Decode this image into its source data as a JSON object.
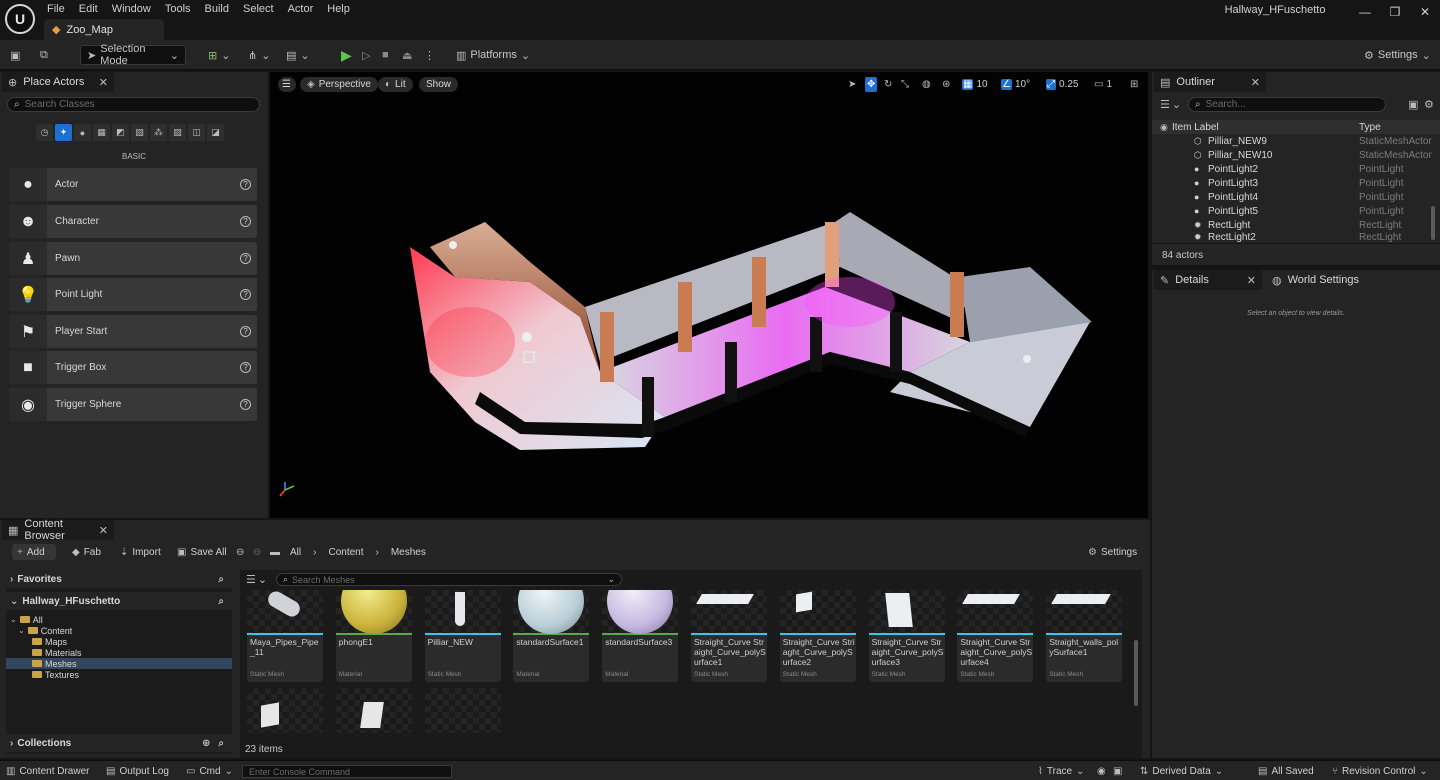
{
  "window": {
    "logo_letter": "U",
    "menu": [
      "File",
      "Edit",
      "Window",
      "Tools",
      "Build",
      "Select",
      "Actor",
      "Help"
    ],
    "document_tab": "Zoo_Map",
    "project_name": "Hallway_HFuschetto"
  },
  "toolbar": {
    "selection_mode": "Selection Mode",
    "platforms": "Platforms",
    "settings": "Settings"
  },
  "place_actors": {
    "tab_label": "Place Actors",
    "search_placeholder": "Search Classes",
    "category_label": "BASIC",
    "items": [
      {
        "label": "Actor"
      },
      {
        "label": "Character"
      },
      {
        "label": "Pawn"
      },
      {
        "label": "Point Light"
      },
      {
        "label": "Player Start"
      },
      {
        "label": "Trigger Box"
      },
      {
        "label": "Trigger Sphere"
      }
    ]
  },
  "viewport": {
    "perspective": "Perspective",
    "lit": "Lit",
    "show": "Show",
    "grid_snap": "10",
    "rotation_snap": "10°",
    "scale_snap": "0.25",
    "camera_speed": "1"
  },
  "outliner": {
    "tab_label": "Outliner",
    "search_placeholder": "Search...",
    "col_label": "Item Label",
    "col_type": "Type",
    "rows": [
      {
        "name": "Pilliar_NEW9",
        "type": "StaticMeshActor"
      },
      {
        "name": "Pilliar_NEW10",
        "type": "StaticMeshActor"
      },
      {
        "name": "PointLight2",
        "type": "PointLight"
      },
      {
        "name": "PointLight3",
        "type": "PointLight"
      },
      {
        "name": "PointLight4",
        "type": "PointLight"
      },
      {
        "name": "PointLight5",
        "type": "PointLight"
      },
      {
        "name": "RectLight",
        "type": "RectLight"
      },
      {
        "name": "RectLight2",
        "type": "RectLight"
      }
    ],
    "count": "84 actors"
  },
  "details": {
    "tab_label": "Details",
    "world_settings": "World Settings",
    "empty_text": "Select an object to view details."
  },
  "content_browser": {
    "tab_label": "Content Browser",
    "add": "Add",
    "fab": "Fab",
    "import": "Import",
    "save_all": "Save All",
    "breadcrumb": [
      "All",
      "Content",
      "Meshes"
    ],
    "settings": "Settings",
    "favorites": "Favorites",
    "project": "Hallway_HFuschetto",
    "tree": [
      "All",
      "Content",
      "Maps",
      "Materials",
      "Meshes",
      "Textures"
    ],
    "collections": "Collections",
    "search_placeholder": "Search Meshes",
    "assets": [
      {
        "name": "Maya_Pipes_Pipe_11",
        "type": "Static Mesh",
        "bar": "#3fc3e8"
      },
      {
        "name": "phongE1",
        "type": "Material",
        "bar": "#5aa84a"
      },
      {
        "name": "Pilliar_NEW",
        "type": "Static Mesh",
        "bar": "#3fc3e8"
      },
      {
        "name": "standardSurface1",
        "type": "Material",
        "bar": "#5aa84a"
      },
      {
        "name": "standardSurface3",
        "type": "Material",
        "bar": "#5aa84a"
      },
      {
        "name": "Straight_Curve Straight_Curve_polySurface1",
        "type": "Static Mesh",
        "bar": "#3fc3e8"
      },
      {
        "name": "Straight_Curve Striaght_Curve_polySurface2",
        "type": "Static Mesh",
        "bar": "#3fc3e8"
      },
      {
        "name": "Straight_Curve Straight_Curve_polySurface3",
        "type": "Static Mesh",
        "bar": "#3fc3e8"
      },
      {
        "name": "Straight_Curve Straight_Curve_polySurface4",
        "type": "Static Mesh",
        "bar": "#3fc3e8"
      },
      {
        "name": "Straight_walls_polySurface1",
        "type": "Static Mesh",
        "bar": "#3fc3e8"
      }
    ],
    "item_count": "23 items"
  },
  "statusbar": {
    "content_drawer": "Content Drawer",
    "output_log": "Output Log",
    "cmd": "Cmd",
    "console_placeholder": "Enter Console Command",
    "trace": "Trace",
    "derived_data": "Derived Data",
    "all_saved": "All Saved",
    "revision_control": "Revision Control"
  }
}
